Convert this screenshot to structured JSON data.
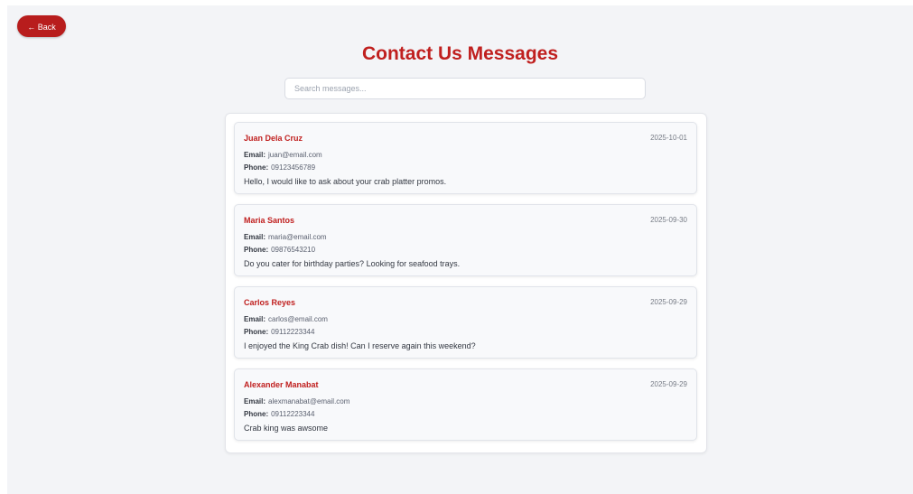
{
  "header": {
    "back_label": "← Back",
    "title": "Contact Us Messages"
  },
  "search": {
    "placeholder": "Search messages...",
    "value": ""
  },
  "labels": {
    "email": "Email:",
    "phone": "Phone:"
  },
  "messages": [
    {
      "name": "Juan Dela Cruz",
      "date": "2025-10-01",
      "email": "juan@email.com",
      "phone": "09123456789",
      "message": "Hello, I would like to ask about your crab platter promos."
    },
    {
      "name": "Maria Santos",
      "date": "2025-09-30",
      "email": "maria@email.com",
      "phone": "09876543210",
      "message": "Do you cater for birthday parties? Looking for seafood trays."
    },
    {
      "name": "Carlos Reyes",
      "date": "2025-09-29",
      "email": "carlos@email.com",
      "phone": "09112223344",
      "message": "I enjoyed the King Crab dish! Can I reserve again this weekend?"
    },
    {
      "name": "Alexander Manabat",
      "date": "2025-09-29",
      "email": "alexmanabat@email.com",
      "phone": "09112223344",
      "message": "Crab king was awsome"
    }
  ],
  "colors": {
    "accent": "#c0201f",
    "button": "#b81d1d",
    "background": "#f3f4f7"
  }
}
